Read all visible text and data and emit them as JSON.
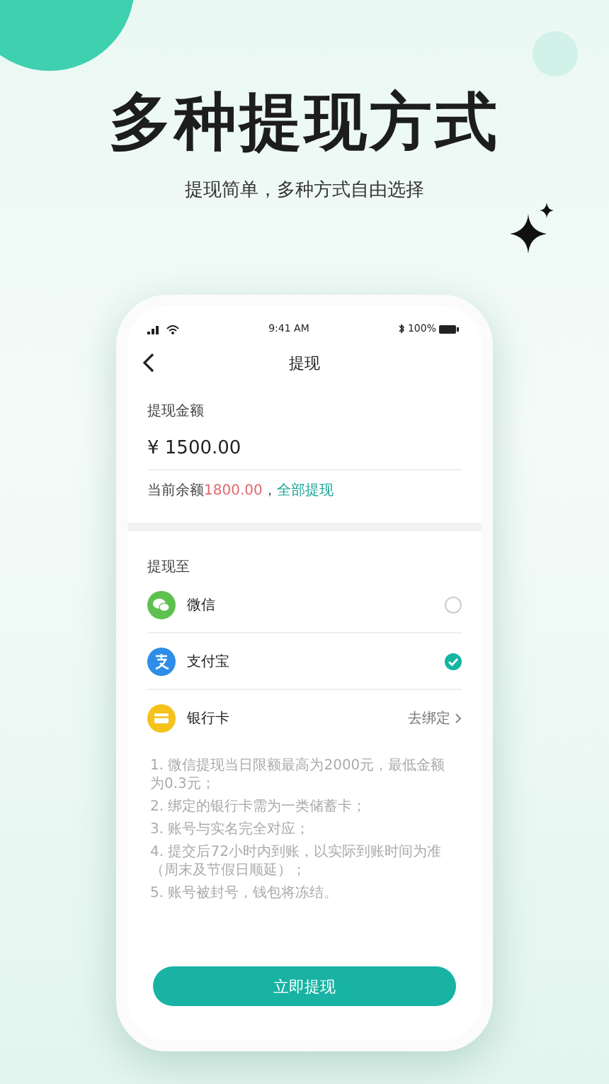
{
  "headline": "多种提现方式",
  "subheadline": "提现简单，多种方式自由选择",
  "phone": {
    "status_bar": {
      "time": "9:41 AM",
      "battery": "100%"
    },
    "nav": {
      "title": "提现"
    },
    "amount": {
      "label": "提现金额",
      "value": "¥ 1500.00",
      "balance_prefix": "当前余额",
      "balance": "1800.00",
      "separator": "，",
      "withdraw_all": "全部提现"
    },
    "methods_label": "提现至",
    "methods": [
      {
        "kind": "wechat",
        "name": "微信",
        "selected": false
      },
      {
        "kind": "alipay",
        "name": "支付宝",
        "selected": true
      },
      {
        "kind": "bank",
        "name": "银行卡",
        "action": "去绑定"
      }
    ],
    "notes": [
      "1. 微信提现当日限额最高为2000元，最低金额为0.3元；",
      "2. 绑定的银行卡需为一类储蓄卡；",
      "3. 账号与实名完全对应；",
      "4. 提交后72小时内到账，以实际到账时间为准（周末及节假日顺延）；",
      "5. 账号被封号，钱包将冻结。"
    ],
    "submit": "立即提现"
  }
}
